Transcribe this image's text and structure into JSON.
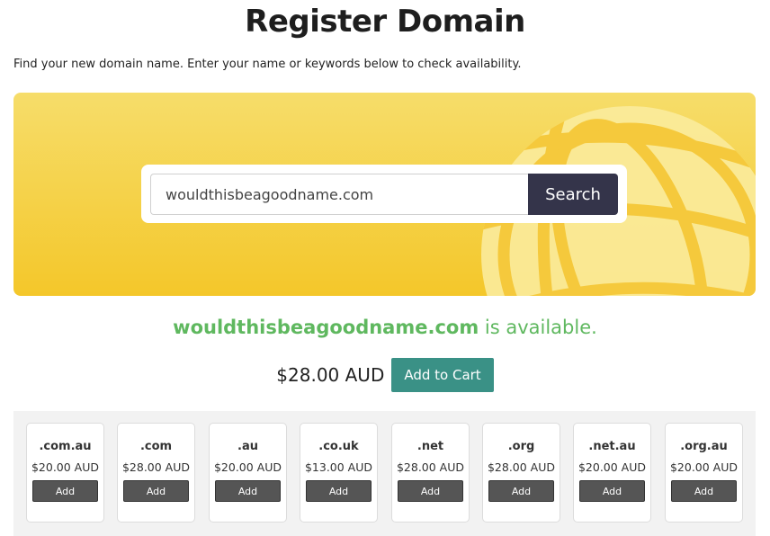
{
  "page": {
    "title": "Register Domain",
    "intro": "Find your new domain name. Enter your name or keywords below to check availability."
  },
  "search": {
    "value": "wouldthisbeagoodname.com",
    "button_label": "Search",
    "globe_icon": "globe-icon"
  },
  "result": {
    "domain": "wouldthisbeagoodname.com",
    "status_text": " is available.",
    "price": "$28.00 AUD",
    "add_to_cart_label": "Add to Cart"
  },
  "colors": {
    "available_green": "#5fb85f",
    "search_button": "#34344a",
    "add_to_cart": "#3a9186",
    "hero_yellow": "#f4c72a"
  },
  "tlds": [
    {
      "name": ".com.au",
      "price": "$20.00 AUD",
      "button": "Add"
    },
    {
      "name": ".com",
      "price": "$28.00 AUD",
      "button": "Add"
    },
    {
      "name": ".au",
      "price": "$20.00 AUD",
      "button": "Add"
    },
    {
      "name": ".co.uk",
      "price": "$13.00 AUD",
      "button": "Add"
    },
    {
      "name": ".net",
      "price": "$28.00 AUD",
      "button": "Add"
    },
    {
      "name": ".org",
      "price": "$28.00 AUD",
      "button": "Add"
    },
    {
      "name": ".net.au",
      "price": "$20.00 AUD",
      "button": "Add"
    },
    {
      "name": ".org.au",
      "price": "$20.00 AUD",
      "button": "Add"
    }
  ]
}
